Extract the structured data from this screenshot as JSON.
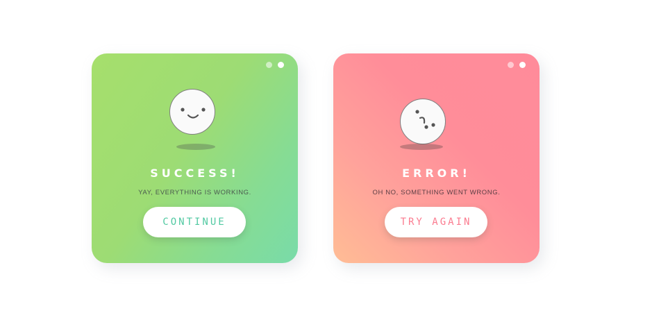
{
  "success_card": {
    "title": "SUCCESS!",
    "message": "YAY, EVERYTHING IS WORKING.",
    "button_label": "CONTINUE",
    "accent_color": "#52c9a2",
    "gradient_colors": [
      "#a6df6c",
      "#79dba9"
    ]
  },
  "error_card": {
    "title": "ERROR!",
    "message": "OH NO, SOMETHING WENT WRONG.",
    "button_label": "TRY AGAIN",
    "accent_color": "#fb7b8f",
    "gradient_colors": [
      "#ffbd95",
      "#ff8b9a"
    ]
  },
  "icons": {
    "success_face": "smiling-face-icon",
    "error_face": "sad-face-icon",
    "window_dots": "window-dots-icon"
  }
}
